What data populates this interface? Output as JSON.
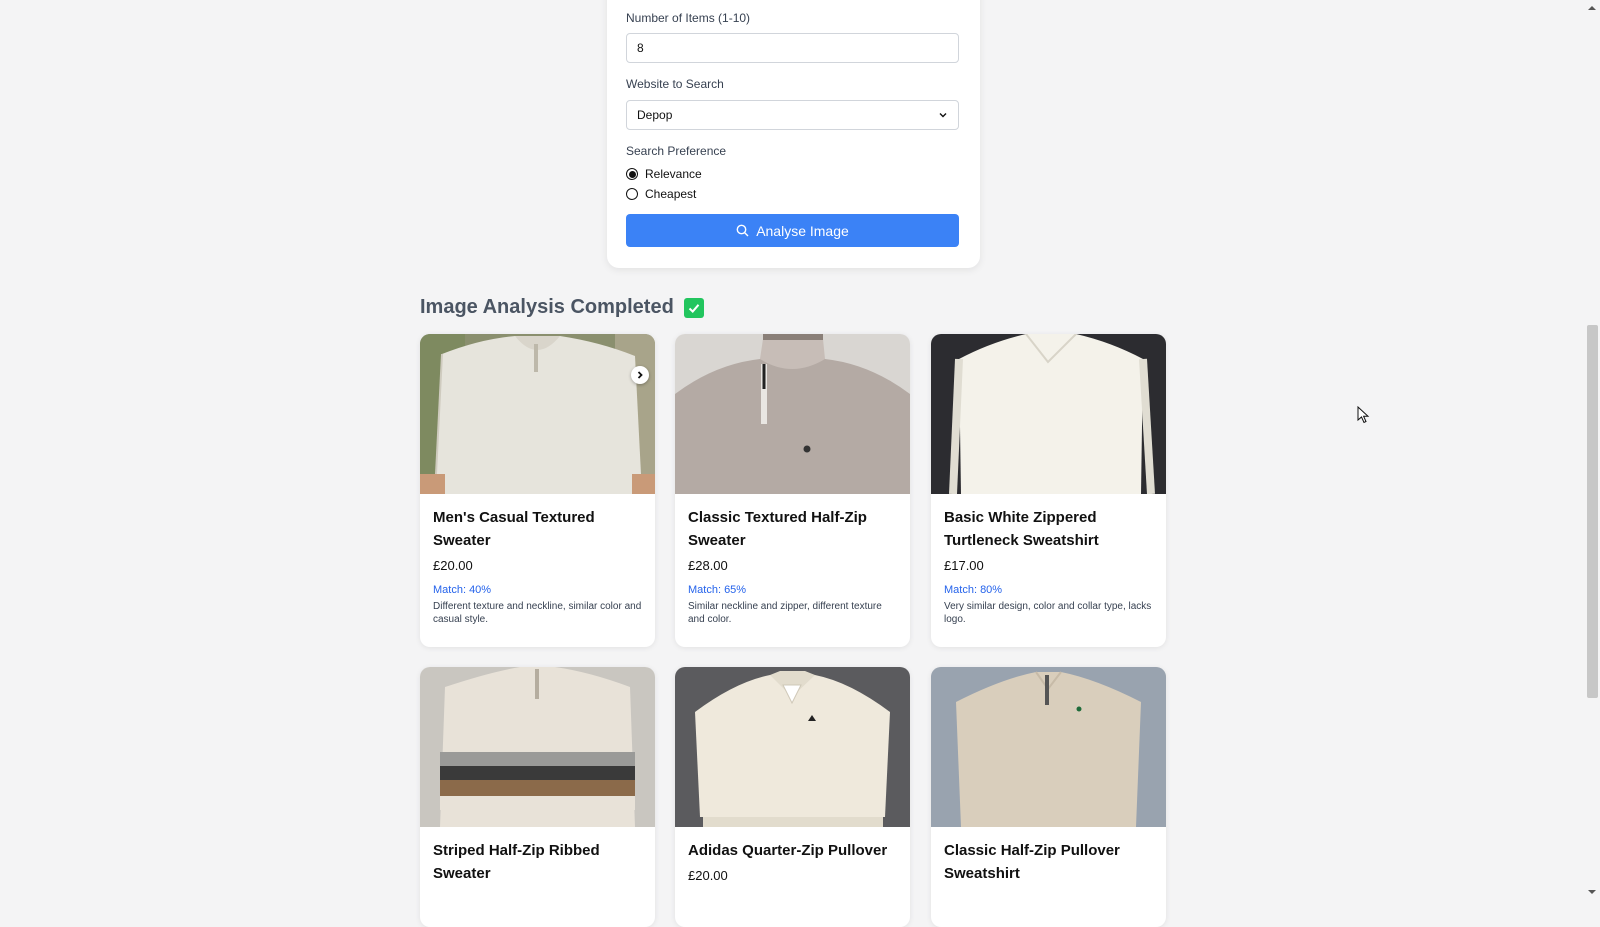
{
  "form": {
    "items_label": "Number of Items (1-10)",
    "items_value": "8",
    "website_label": "Website to Search",
    "website_value": "Depop",
    "preference_label": "Search Preference",
    "options": [
      "Relevance",
      "Cheapest"
    ],
    "selected_option": "Relevance",
    "analyse_label": "Analyse Image",
    "analyse_icon": "search-icon"
  },
  "results": {
    "heading": "Image Analysis Completed",
    "heading_icon": "check-icon",
    "items": [
      {
        "title": "Men's Casual Textured Sweater",
        "price": "£20.00",
        "match": "Match: 40%",
        "desc": "Different texture and neckline, similar color and casual style."
      },
      {
        "title": "Classic Textured Half-Zip Sweater",
        "price": "£28.00",
        "match": "Match: 65%",
        "desc": "Similar neckline and zipper, different texture and color."
      },
      {
        "title": "Basic White Zippered Turtleneck Sweatshirt",
        "price": "£17.00",
        "match": "Match: 80%",
        "desc": "Very similar design, color and collar type, lacks logo."
      },
      {
        "title": "Striped Half-Zip Ribbed Sweater",
        "price": "",
        "match": "",
        "desc": ""
      },
      {
        "title": "Adidas Quarter-Zip Pullover",
        "price": "£20.00",
        "match": "",
        "desc": ""
      },
      {
        "title": "Classic Half-Zip Pullover Sweatshirt",
        "price": "",
        "match": "",
        "desc": ""
      }
    ]
  },
  "colors": {
    "accent": "#3b82f6",
    "match_text": "#2563eb",
    "success": "#22c55e",
    "background": "#f4f4f5"
  }
}
